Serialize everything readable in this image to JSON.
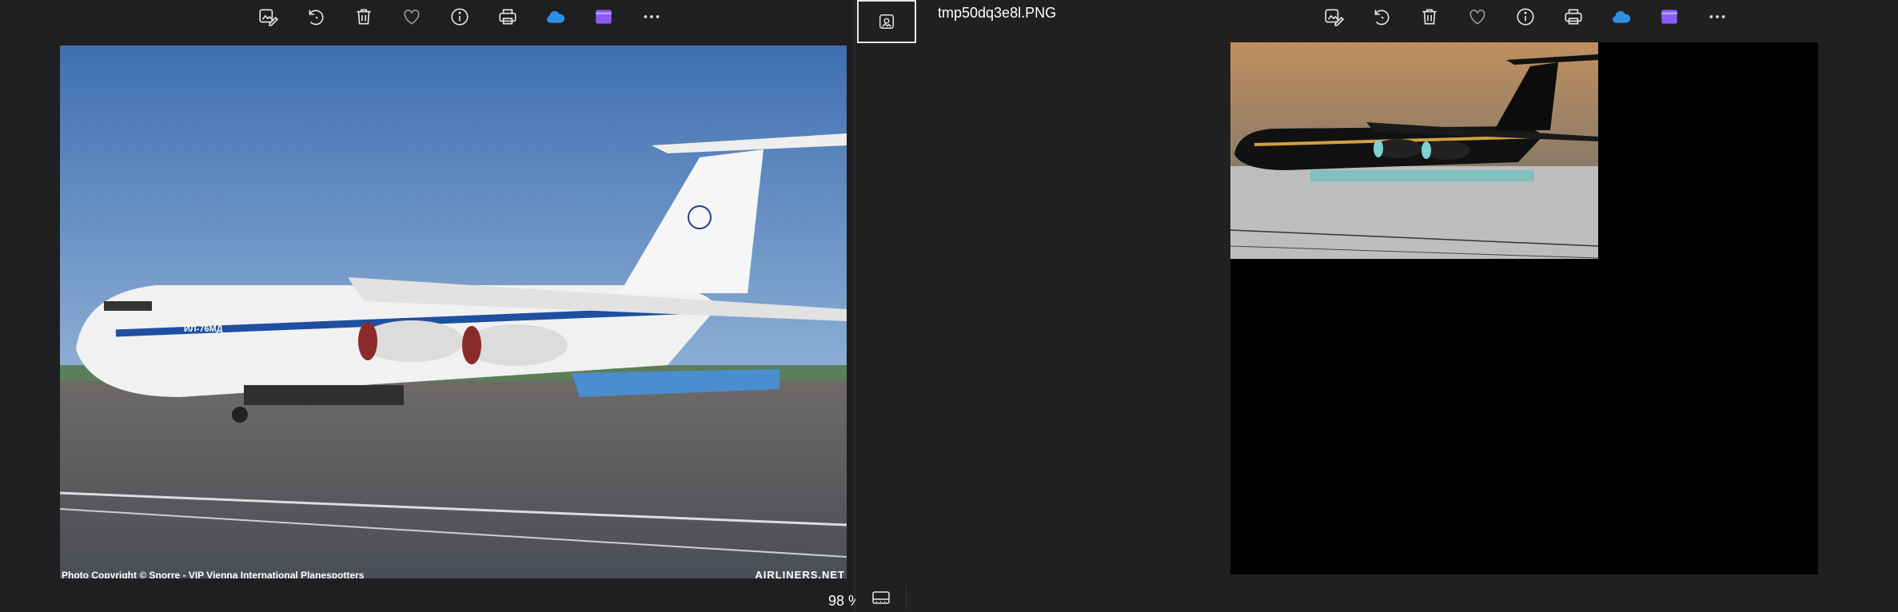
{
  "left_viewer": {
    "toolbar": [
      {
        "icon": "edit-image-icon",
        "label": "Edit image"
      },
      {
        "icon": "rotate-icon",
        "label": "Rotate"
      },
      {
        "icon": "delete-icon",
        "label": "Delete"
      },
      {
        "icon": "heart-icon",
        "label": "Favorite"
      },
      {
        "icon": "info-icon",
        "label": "File info"
      },
      {
        "icon": "print-icon",
        "label": "Print"
      },
      {
        "icon": "onedrive-icon",
        "label": "OneDrive"
      },
      {
        "icon": "clipchamp-icon",
        "label": "Clipchamp"
      },
      {
        "icon": "more-icon",
        "label": "See more"
      }
    ],
    "photo": {
      "credit": "Photo Copyright © Snorre - VIP Vienna International Planespotters",
      "watermark": "AIRLINERS.NET",
      "registration": "ИЛ-76МД"
    },
    "zoom": "98 %"
  },
  "right_viewer": {
    "filename": "tmp50dq3e8l.PNG",
    "toolbar": [
      {
        "icon": "edit-image-icon",
        "label": "Edit image"
      },
      {
        "icon": "rotate-icon",
        "label": "Rotate"
      },
      {
        "icon": "delete-icon",
        "label": "Delete"
      },
      {
        "icon": "heart-icon",
        "label": "Favorite"
      },
      {
        "icon": "info-icon",
        "label": "File info"
      },
      {
        "icon": "print-icon",
        "label": "Print"
      },
      {
        "icon": "onedrive-icon",
        "label": "OneDrive"
      },
      {
        "icon": "clipchamp-icon",
        "label": "Clipchamp"
      },
      {
        "icon": "more-icon",
        "label": "See more"
      }
    ]
  },
  "colors": {
    "background": "#1f1f1f",
    "onedrive": "#2f8fe6",
    "clipchamp": "#8a5cf6",
    "sky": "#5b86c0",
    "inverted_sky": "#c29a70"
  }
}
